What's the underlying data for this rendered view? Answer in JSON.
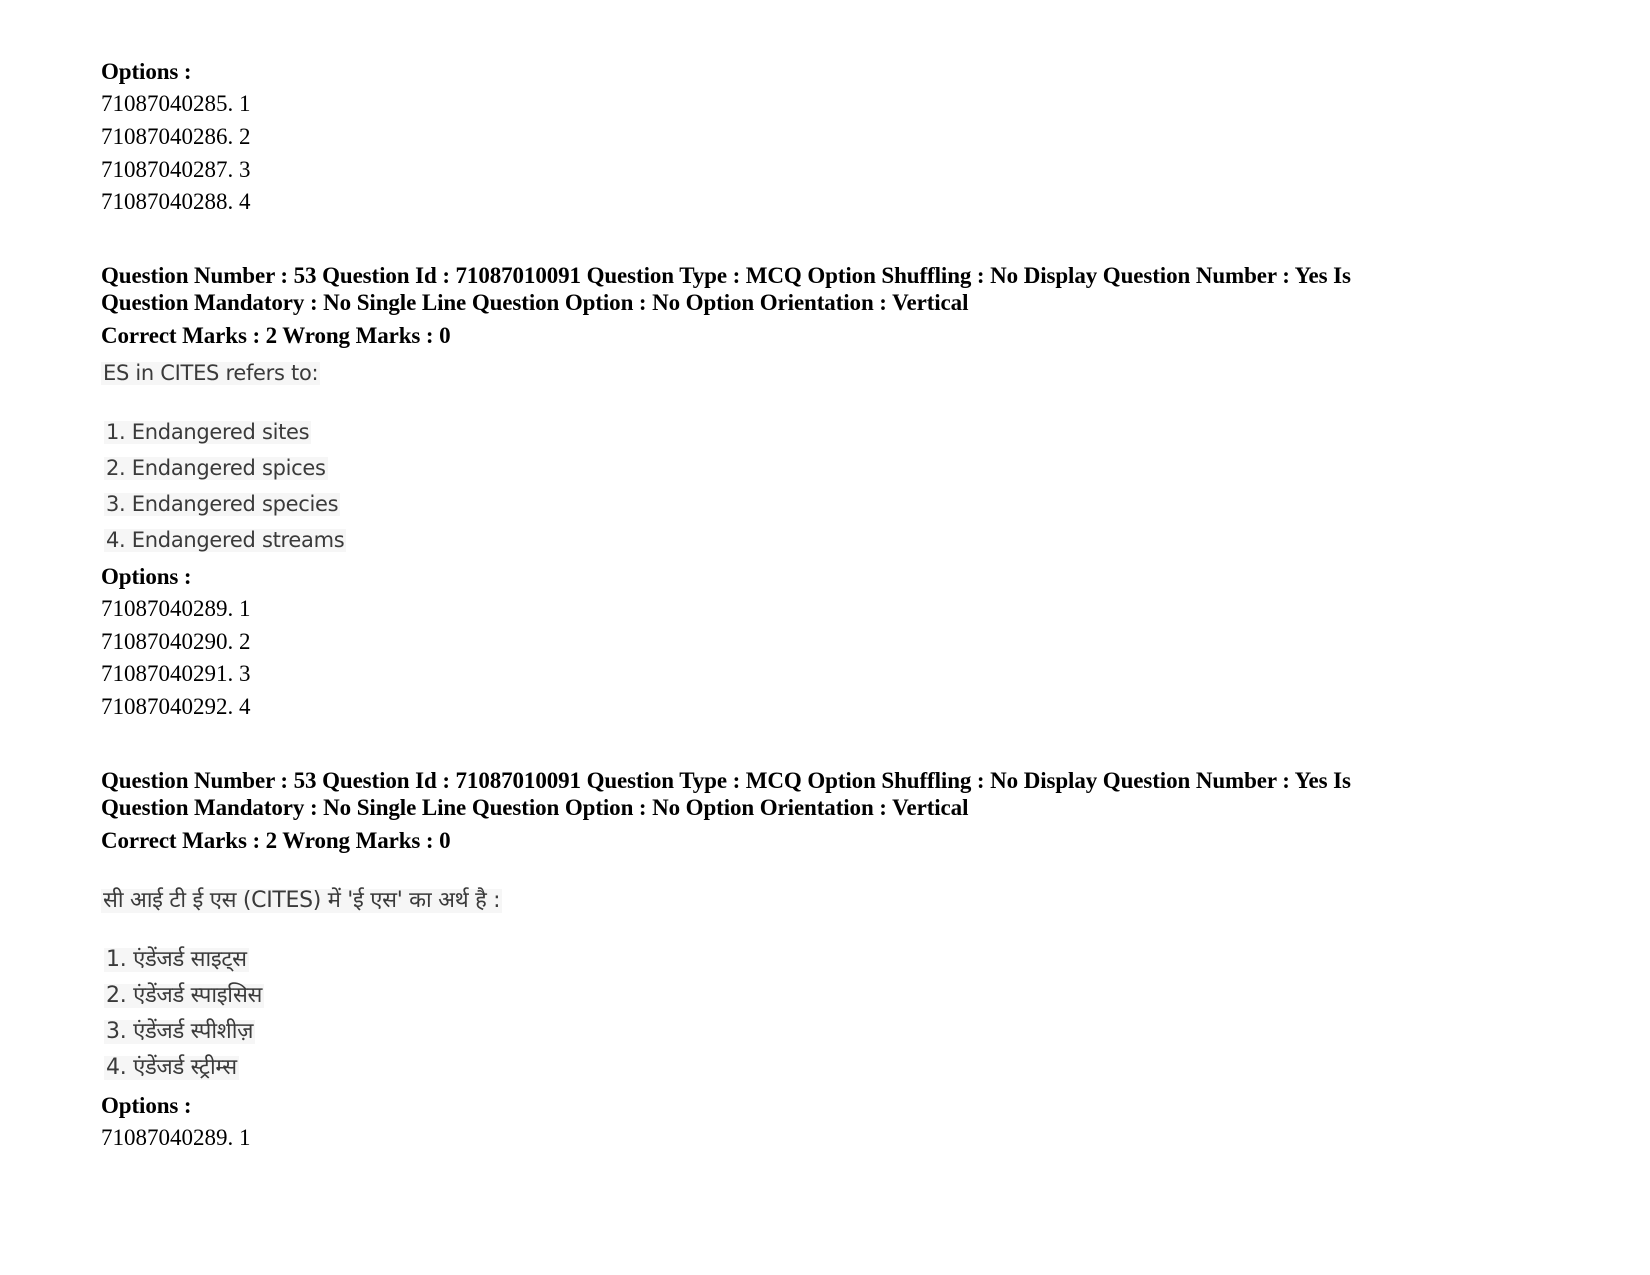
{
  "blocks": [
    {
      "options_label": "Options :",
      "options": [
        "71087040285. 1",
        "71087040286. 2",
        "71087040287. 3",
        "71087040288. 4"
      ]
    },
    {
      "header_line1": "Question Number : 53 Question Id : 71087010091 Question Type : MCQ Option Shuffling : No Display Question Number : Yes Is",
      "header_line2": "Question Mandatory : No Single Line Question Option : No Option Orientation : Vertical",
      "marks": "Correct Marks : 2 Wrong Marks : 0",
      "question_text": "ES in CITES refers to:",
      "choices": [
        "1. Endangered sites",
        "2. Endangered spices",
        "3. Endangered species",
        "4. Endangered streams"
      ],
      "options_label": "Options :",
      "options": [
        "71087040289. 1",
        "71087040290. 2",
        "71087040291. 3",
        "71087040292. 4"
      ]
    },
    {
      "header_line1": "Question Number : 53 Question Id : 71087010091 Question Type : MCQ Option Shuffling : No Display Question Number : Yes Is",
      "header_line2": "Question Mandatory : No Single Line Question Option : No Option Orientation : Vertical",
      "marks": "Correct Marks : 2 Wrong Marks : 0",
      "question_text": "सी आई टी ई एस (CITES) में  'ई एस' का अर्थ है :",
      "choices": [
        "1. एंडेंजर्ड साइट्स",
        "2. एंडेंजर्ड स्पाइसिस",
        "3. एंडेंजर्ड स्पीशीज़",
        "4. एंडेंजर्ड स्ट्रीम्स"
      ],
      "options_label": "Options :",
      "options": [
        "71087040289. 1"
      ]
    }
  ]
}
